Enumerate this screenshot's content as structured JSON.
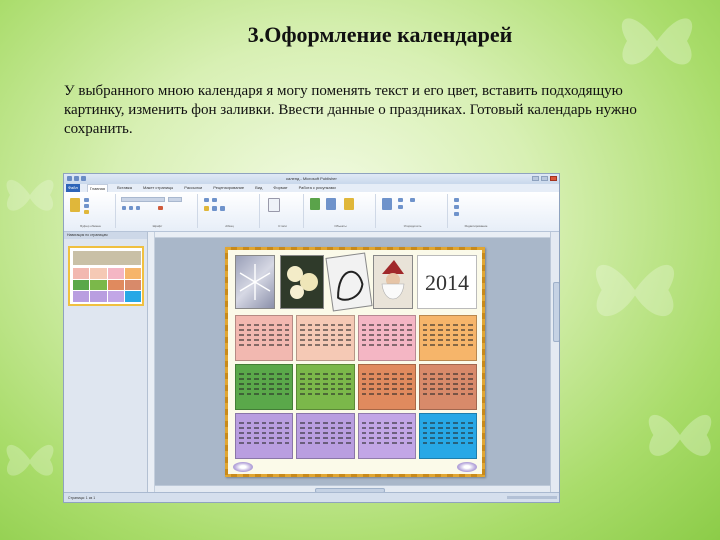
{
  "slide": {
    "title": "3.Оформление календарей",
    "body_text": "У выбранного мною календаря я могу поменять текст и его цвет, вставить подходящую картинку, изменить фон заливки. Ввести данные о праздниках. Готовый календарь нужно сохранить."
  },
  "screenshot": {
    "window_title": "календ - Microsoft Publisher",
    "ribbon_tabs": [
      "Файл",
      "Главная",
      "Вставка",
      "Макет страницы",
      "Рассылки",
      "Рецензирование",
      "Вид",
      "Формат",
      "Работа с рисунками"
    ],
    "active_tab": "Главная",
    "ribbon_groups": [
      "Буфер обмена",
      "Шрифт",
      "Абзац",
      "Стили",
      "Объекты",
      "Упорядочить",
      "Редактирование"
    ],
    "nav_header": "Навигация по страницам",
    "calendar_year": "2014",
    "month_colors": [
      "#f2b8b0",
      "#f5c9b5",
      "#f4b6c4",
      "#f6b56a",
      "#5aa84a",
      "#7bb84a",
      "#e08a5e",
      "#d88a6a",
      "#b99ee0",
      "#b99ee0",
      "#c2a6e6",
      "#27a8e6"
    ],
    "status_text": "Страница: 1 из 1"
  }
}
